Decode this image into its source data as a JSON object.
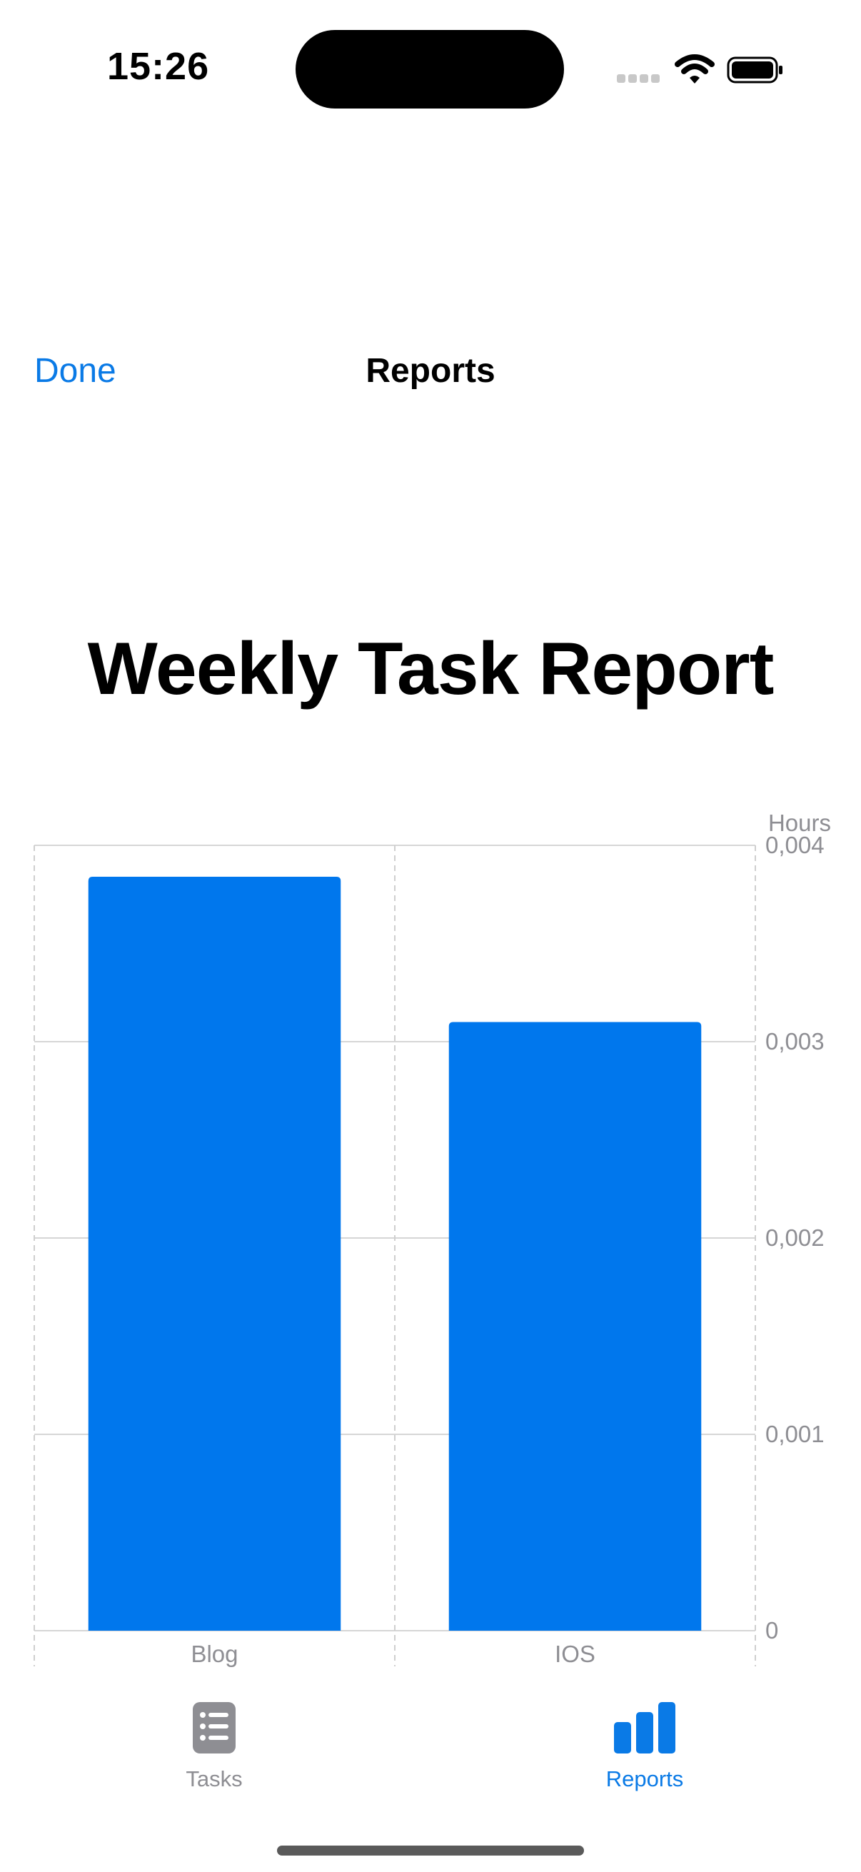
{
  "status_bar": {
    "time": "15:26",
    "icons": [
      "signal-icon",
      "wifi-icon",
      "battery-icon"
    ]
  },
  "nav": {
    "done_label": "Done",
    "title": "Reports"
  },
  "report": {
    "title": "Weekly Task Report"
  },
  "colors": {
    "accent": "#0a7ae6",
    "bar": "#0077ed",
    "muted": "#8e8e93",
    "grid": "#d6d6d6"
  },
  "chart_data": {
    "type": "bar",
    "categories": [
      "Blog",
      "IOS"
    ],
    "values": [
      0.00384,
      0.0031
    ],
    "ylabel": "Hours",
    "ylim": [
      0,
      0.004
    ],
    "yticks": [
      0,
      0.001,
      0.002,
      0.003,
      0.004
    ],
    "ytick_labels": [
      "0",
      "0,001",
      "0,002",
      "0,003",
      "0,004"
    ],
    "grid": true,
    "y_axis_side": "right"
  },
  "tabbar": {
    "tabs": [
      {
        "label": "Tasks",
        "icon": "tasks-list-icon",
        "selected": false
      },
      {
        "label": "Reports",
        "icon": "bar-chart-icon",
        "selected": true
      }
    ]
  }
}
